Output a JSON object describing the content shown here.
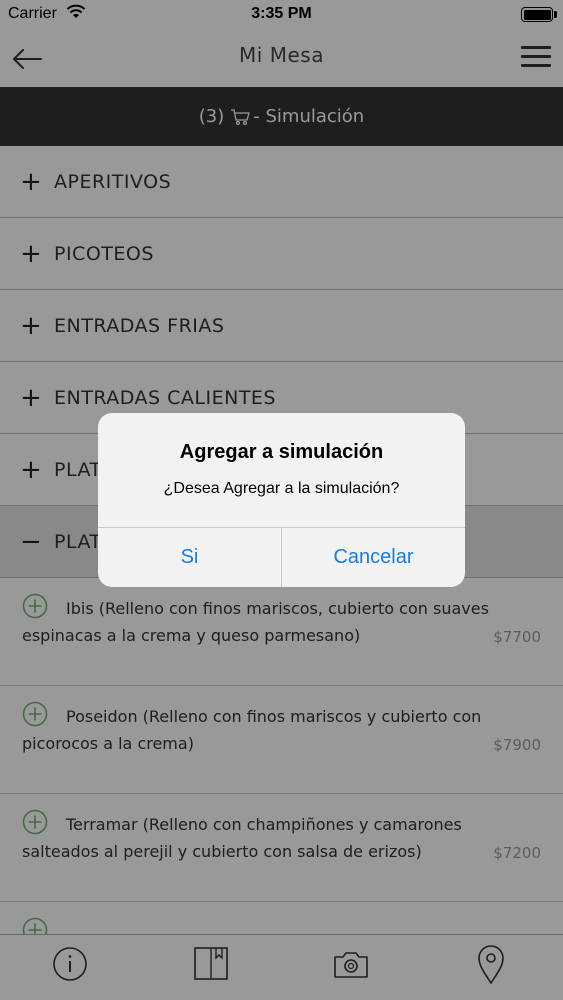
{
  "status_bar": {
    "carrier": "Carrier",
    "time": "3:35 PM"
  },
  "nav": {
    "title": "Mi Mesa",
    "back_icon": "back-arrow-icon",
    "menu_icon": "hamburger-menu-icon"
  },
  "simulation_bar": {
    "count": "(3)",
    "label": "- Simulación",
    "icon": "cart-icon"
  },
  "categories": [
    {
      "label": "APERITIVOS",
      "toggle": "+"
    },
    {
      "label": "PICOTEOS",
      "toggle": "+"
    },
    {
      "label": "ENTRADAS FRIAS",
      "toggle": "+"
    },
    {
      "label": "ENTRADAS CALIENTES",
      "toggle": "+"
    },
    {
      "label": "PLAT",
      "toggle": "+"
    },
    {
      "label": "PLAT",
      "toggle": "−"
    }
  ],
  "items": [
    {
      "name": "Ibis (Relleno con finos mariscos, cubierto con suaves espinacas a la crema y queso parmesano)",
      "price": "$7700"
    },
    {
      "name": "Poseidon (Relleno con finos mariscos y cubierto con picorocos a la crema)",
      "price": "$7900"
    },
    {
      "name": "Terramar (Relleno con champiñones y camarones salteados al perejil y cubierto con salsa de erizos)",
      "price": "$7200"
    }
  ],
  "tab_bar": {
    "icons": [
      "info-icon",
      "menu-book-icon",
      "camera-icon",
      "location-pin-icon"
    ]
  },
  "alert": {
    "title": "Agregar a simulación",
    "message": "¿Desea Agregar a la simulación?",
    "confirm_label": "Si",
    "cancel_label": "Cancelar"
  },
  "colors": {
    "accent": "#1a7bd8",
    "add_icon": "#6db56d",
    "header_bar": "#333333"
  }
}
